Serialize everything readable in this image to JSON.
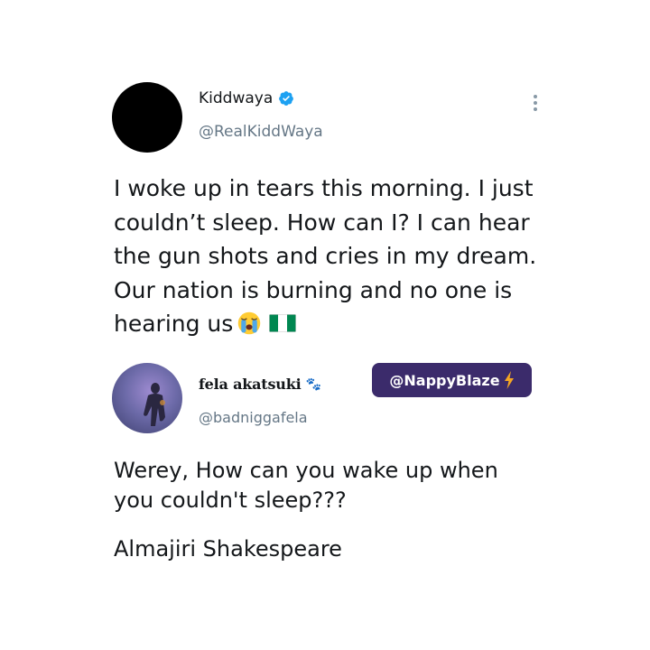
{
  "tweet": {
    "author_name": "Kiddwaya",
    "handle": "@RealKiddWaya",
    "verified": true,
    "text_lines": [
      "I woke up in tears this morning. I just",
      "couldn’t sleep. How can I? I can hear",
      "the gun shots and cries in my dream.",
      "Our nation is burning and no one is",
      "hearing us"
    ],
    "emojis": [
      "loudly-crying-face-icon",
      "nigeria-flag-icon"
    ]
  },
  "reply": {
    "author_name": "fela akatsuki",
    "handle": "@badniggafela",
    "text_lines": [
      "Werey, How can you wake up when",
      "you couldn't sleep???"
    ],
    "signoff": "Almajiri Shakespeare"
  },
  "watermark": {
    "label": "@NappyBlaze"
  },
  "colors": {
    "verified_blue": "#1da1f2",
    "handle_gray": "#657786",
    "watermark_bg": "#3b2b6b",
    "bolt": "#f5a623",
    "flag_green": "#008751"
  }
}
